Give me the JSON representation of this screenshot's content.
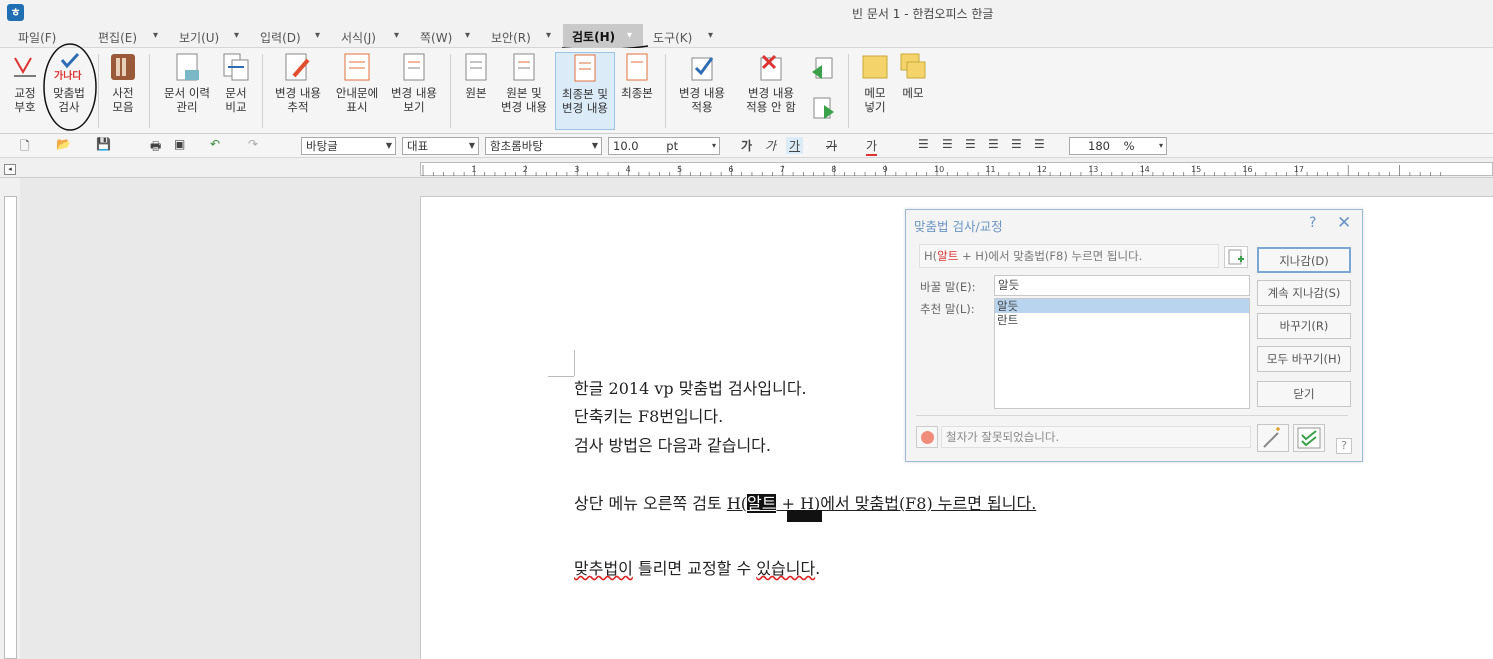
{
  "titlebar": {
    "title": "빈 문서 1 - 한컴오피스 한글",
    "app_icon": "hancom-app-icon"
  },
  "menu": [
    {
      "label": "파일(F)"
    },
    {
      "label": "편집(E)"
    },
    {
      "label": "보기(U)"
    },
    {
      "label": "입력(D)"
    },
    {
      "label": "서식(J)"
    },
    {
      "label": "쪽(W)"
    },
    {
      "label": "보안(R)"
    },
    {
      "label": "검토(H)",
      "active": true
    },
    {
      "label": "도구(K)"
    }
  ],
  "ribbon": {
    "proof_mark": "교정\n부호",
    "spell_check": "맞춤법\n검사",
    "spell_check_icon_text": "가나다",
    "dictionary": "사전\n모음",
    "doc_history": "문서 이력\n관리",
    "doc_compare": "문서\n비교",
    "track_changes": "변경 내용\n추적",
    "balloon_show": "안내문에\n표시",
    "view_changes": "변경 내용\n보기",
    "original": "원본",
    "original_and_changes": "원본 및\n변경 내용",
    "final_and_changes": "최종본 및\n변경 내용",
    "final": "최종본",
    "apply_change": "변경 내용\n적용",
    "reject_change": "변경 내용\n적용 안 함",
    "insert_memo": "메모\n넣기",
    "memo": "메모"
  },
  "toolbar": {
    "style": "바탕글",
    "lang": "대표",
    "font": "함초롬바탕",
    "size": "10.0",
    "size_unit": "pt",
    "zoom": "180",
    "zoom_unit": "%",
    "bold": "가",
    "italic": "가",
    "underline": "가",
    "strike": "가",
    "color": "가"
  },
  "ruler": {
    "h_ticks": [
      "1",
      "2",
      "3",
      "4",
      "5",
      "6",
      "7",
      "8",
      "9",
      "10",
      "11",
      "12",
      "13",
      "14",
      "15",
      "16",
      "17"
    ]
  },
  "document": {
    "line1": "한글 2014 vp 맞춤법 검사입니다.",
    "line2": "단축키는 F8번입니다.",
    "line3": "검사 방법은 다음과 같습니다.",
    "line4_prefix": "상단 메뉴 오른쪽 검토 ",
    "line4_u1": "H(",
    "line4_hl": "알트",
    "line4_u2": " + H)에서 맞춤법(F8) 누르면 됩니다.",
    "line5_wrong": "맞추법이",
    "line5_a": " 틀리면 교정할 수 ",
    "line5_wrong2": "있습니다",
    "line5_end": "."
  },
  "dialog": {
    "title": "맞춤법 검사/교정",
    "help": "?",
    "close": "✕",
    "context_pre": "H(",
    "context_word": "알트",
    "context_post": " + H)에서 맞춤법(F8) 누르면 됩니다.",
    "replace_label": "바꿀 말(E):",
    "replace_value": "알듯",
    "suggest_label": "추천 말(L):",
    "suggestions": [
      "알듯",
      "란트"
    ],
    "btn_skip": "지나감(D)",
    "btn_skip_all": "계속 지나감(S)",
    "btn_change": "바꾸기(R)",
    "btn_change_all": "모두 바꾸기(H)",
    "btn_close": "닫기",
    "status": "철자가 잘못되었습니다.",
    "small_help": "?"
  }
}
